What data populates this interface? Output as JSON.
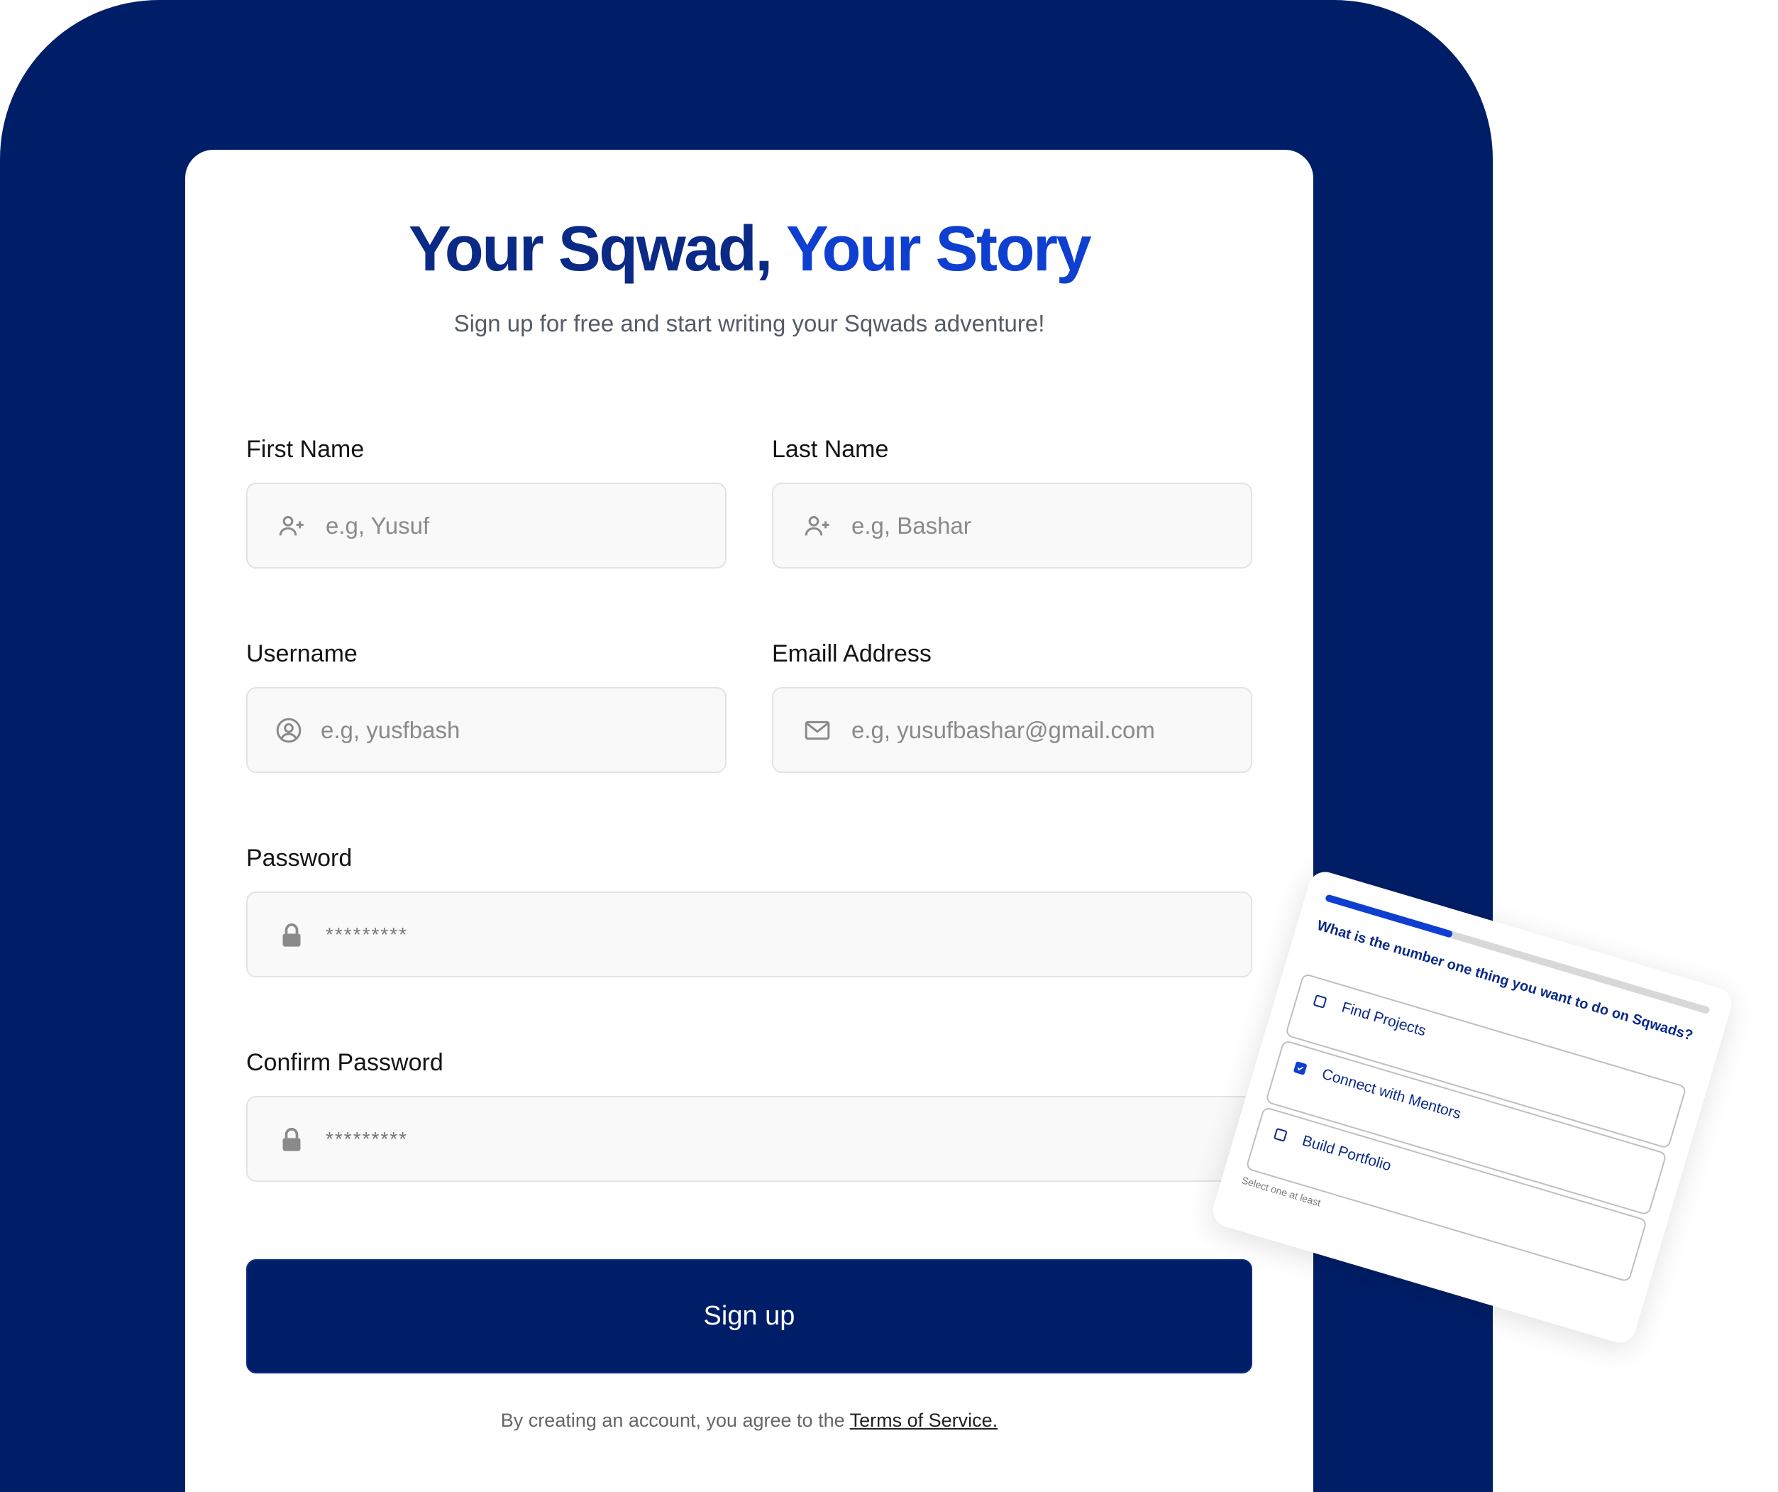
{
  "header": {
    "title_part1": "Your Sqwad,",
    "title_part2": "Your Story",
    "subtitle": "Sign up for free and start writing your Sqwads adventure!"
  },
  "form": {
    "first_name": {
      "label": "First Name",
      "placeholder": "e.g, Yusuf",
      "icon": "user-plus-icon"
    },
    "last_name": {
      "label": "Last Name",
      "placeholder": "e.g, Bashar",
      "icon": "user-plus-icon"
    },
    "username": {
      "label": "Username",
      "placeholder": "e.g, yusfbash",
      "icon": "user-circle-icon"
    },
    "email": {
      "label": "Emaill Address",
      "placeholder": "e.g, yusufbashar@gmail.com",
      "icon": "mail-icon"
    },
    "password": {
      "label": "Password",
      "placeholder": "*********",
      "icon": "lock-icon"
    },
    "confirm_password": {
      "label": "Confirm Password",
      "placeholder": "*********",
      "icon": "lock-icon"
    },
    "submit_label": "Sign up",
    "terms_prefix": "By creating an account, you agree to the",
    "terms_link": "Terms of Service."
  },
  "quiz": {
    "progress": 0.33,
    "question": "What is the number one thing you want to do on Sqwads?",
    "options": [
      {
        "label": "Find Projects",
        "checked": false
      },
      {
        "label": "Connect with Mentors",
        "checked": true
      },
      {
        "label": "Build Portfolio",
        "checked": false
      }
    ],
    "hint": "Select one at least"
  },
  "colors": {
    "navy": "#001e68",
    "title_dark": "#0a2a86",
    "title_bright": "#0e3fd0",
    "field_bg": "#f9f9f9"
  }
}
